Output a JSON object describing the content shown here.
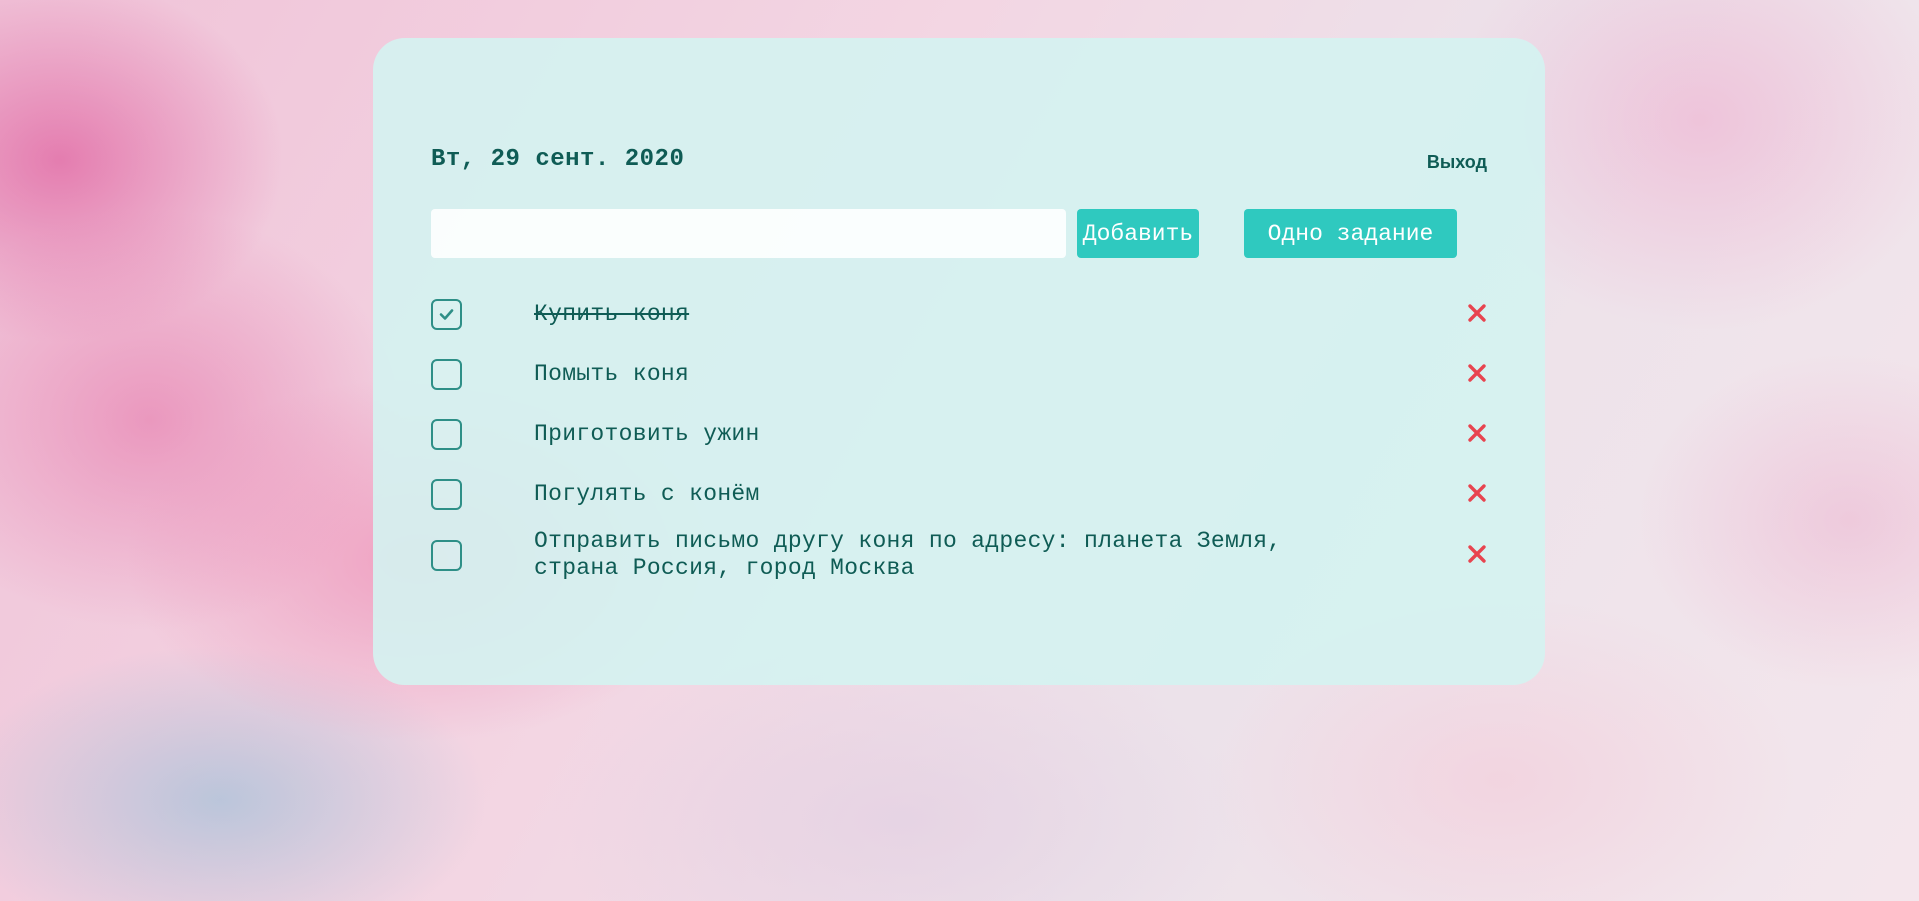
{
  "header": {
    "date": "Вт, 29 сент. 2020",
    "logout_label": "Выход"
  },
  "new_task": {
    "value": "",
    "placeholder": "",
    "add_label": "Добавить",
    "one_task_label": "Одно задание"
  },
  "tasks": [
    {
      "text": "Купить коня",
      "completed": true
    },
    {
      "text": "Помыть коня",
      "completed": false
    },
    {
      "text": "Приготовить ужин",
      "completed": false
    },
    {
      "text": "Погулять с конём",
      "completed": false
    },
    {
      "text": "Отправить письмо другу коня по адресу: планета Земля, страна Россия, город Москва",
      "completed": false
    }
  ],
  "icons": {
    "checkbox_mark": "check-icon",
    "delete": "close-icon"
  },
  "colors": {
    "accent": "#2fc9bf",
    "text": "#0f5c55",
    "delete": "#e8444f",
    "card": "#d4f3f1"
  }
}
